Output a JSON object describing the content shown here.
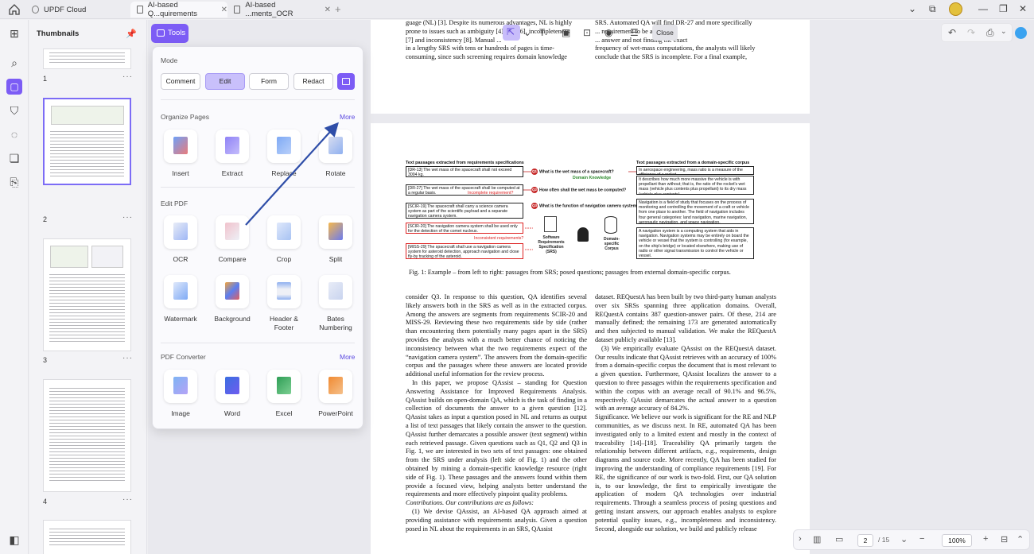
{
  "tabs": [
    {
      "label": "UPDF Cloud"
    },
    {
      "label": "AI-based Q...quirements"
    },
    {
      "label": "AI-based ...ments_OCR"
    }
  ],
  "sidebar": {
    "title": "Thumbnails",
    "pages": [
      "1",
      "2",
      "3",
      "4"
    ]
  },
  "tools_button": {
    "label": "Tools"
  },
  "popup": {
    "mode_title": "Mode",
    "modes": [
      "Comment",
      "Edit",
      "Form",
      "Redact"
    ],
    "active_mode": "Edit",
    "organize": {
      "title": "Organize Pages",
      "more": "More",
      "items": [
        "Insert",
        "Extract",
        "Replace",
        "Rotate"
      ]
    },
    "edit": {
      "title": "Edit PDF",
      "items": [
        "OCR",
        "Compare",
        "Crop",
        "Split",
        "Watermark",
        "Background",
        "Header & Footer",
        "Bates Numbering"
      ]
    },
    "converter": {
      "title": "PDF Converter",
      "more": "More",
      "items": [
        "Image",
        "Word",
        "Excel",
        "PowerPoint"
      ]
    }
  },
  "doc_toolbar": {
    "close": "Close"
  },
  "status": {
    "page": "2",
    "total": "/ 15",
    "zoom": "100%"
  },
  "page1": {
    "left": [
      "guage (NL) [3]. Despite its numerous advantages, NL is highly",
      "prone to issues such as ambiguity [4], [5], [6], incompleteness",
      "[7] and inconsistency [8]. Manual ...",
      "in a lengthy SRS with tens or hundreds of pages is time-",
      "consuming, since such screening requires domain knowledge"
    ],
    "right": [
      "SRS. Automated QA will find DR-27 and more specifically",
      "... requirement to be an",
      "... answer and not finding the exact",
      "frequency of wet-mass computations, the analysts will likely",
      "conclude that the SRS is incomplete. For a final example,"
    ]
  },
  "figure": {
    "left_title": "Text passages extracted from requirements specifications",
    "right_title": "Text passages extracted from a domain-specific corpus",
    "dr13": "[DR-13] The wet mass of the spacecraft shall not exceed 3004 kg.",
    "dr27": "[DR-27] The wet mass of the spacecraft shall be computed at a regular basis.",
    "incomplete": "Incomplete requirement?",
    "scir19": "[SCIR-19] The spacecraft shall carry a science camera system as part of the scientific payload and a separate navigation camera system.",
    "scir20": "[SCIR-20] The navigation camera system shall be used only for the detection of the comet nucleus.",
    "inconsistent": "Inconsistent requirements?",
    "miss29": "[MISS-29] The spacecraft shall use a navigation camera system for asteroid detection, approach navigation and close fly-by tracking of the asteroid.",
    "q1": "What is the wet mass of a spacecraft?",
    "domain_knowledge": "Domain Knowledge",
    "q2": "How often shall the wet mass be computed?",
    "q3": "What is the function of navigation camera system?",
    "srs_label": "Software Requirements Specification (SRS)",
    "corpus_label": "Domain-specific Corpus",
    "r1": "In aerospace engineering, mass ratio is a measure of the efficiency of a rocket.",
    "r2": "It describes how much more massive the vehicle is with propellant than without; that is, the ratio of the rocket's wet mass (vehicle plus contents plus propellant) to its dry mass (vehicle plus contents).",
    "r3": "Navigation is a field of study that focuses on the process of monitoring and controlling the movement of a craft or vehicle from one place to another. The field of navigation includes four general categories: land navigation, marine navigation, aeronautic navigation, and space navigation.",
    "r4": "A navigation system is a computing system that aids in navigation. Navigation systems may be entirely on board the vehicle or vessel that the system is controlling (for example, on the ship's bridge) or located elsewhere, making use of radio or other signal transmission to control the vehicle or vessel.",
    "caption": "Fig. 1: Example – from left to right: passages from SRS; posed questions; passages from external domain-specific corpus."
  },
  "page2": {
    "left": [
      "consider Q3. In response to this question, QA identifies several likely answers both in the SRS as well as in the extracted corpus. Among the answers are segments from requirements SCIR-20 and MISS-29. Reviewing these two requirements side by side (rather than encountering them potentially many pages apart in the SRS) provides the analysts with a much better chance of noticing the inconsistency between what the two requirements expect of the “navigation camera system”. The answers from the domain-specific corpus and the passages where these answers are located provide additional useful information for the review process.",
      "In this paper, we propose QAssist – standing for Question Answering Assistance for Improved Requirements Analysis. QAssist builds on open-domain QA, which is the task of finding in a collection of documents the answer to a given question [12]. QAssist takes as input a question posed in NL and returns as output a list of text passages that likely contain the answer to the question. QAssist further demarcates a possible answer (text segment) within each retrieved passage. Given questions such as Q1, Q2 and Q3 in Fig. 1, we are interested in two sets of text passages: one obtained from the SRS under analysis (left side of Fig. 1) and the other obtained by mining a domain-specific knowledge resource (right side of Fig. 1). These passages and the answers found within them provide a focused view, helping analysts better understand the requirements and more effectively pinpoint quality problems.",
      "Contributions. Our contributions are as follows:",
      "(1) We devise QAssist, an AI-based QA approach aimed at providing assistance with requirements analysis. Given a question posed in NL about the requirements in an SRS, QAssist"
    ],
    "right": [
      "dataset. REQuestA has been built by two third-party human analysts over six SRSs spanning three application domains. Overall, REQuestA contains 387 question-answer pairs. Of these, 214 are manually defined; the remaining 173 are generated automatically and then subjected to manual validation. We make the REQuestA dataset publicly available [13].",
      "(3) We empirically evaluate QAssist on the REQuestA dataset. Our results indicate that QAssist retrieves with an accuracy of 100% from a domain-specific corpus the document that is most relevant to a given question. Furthermore, QAssist localizes the answer to a question to three passages within the requirements specification and within the corpus with an average recall of 90.1% and 96.5%, respectively. QAssist demarcates the actual answer to a question with an average accuracy of 84.2%.",
      "Significance. We believe our work is significant for the RE and NLP communities, as we discuss next. In RE, automated QA has been investigated only to a limited extent and mostly in the context of traceability [14]–[18]. Traceability QA primarily targets the relationship between different artifacts, e.g., requirements, design diagrams and source code. More recently, QA has been studied for improving the understanding of compliance requirements [19]. For RE, the significance of our work is two-fold. First, our QA solution is, to our knowledge, the first to empirically investigate the application of modern QA technologies over industrial requirements. Through a seamless process of posing questions and getting instant answers, our approach enables analysts to explore potential quality issues, e.g., incompleteness and inconsistency. Second, alongside our solution, we build and publicly release"
    ]
  },
  "colors": {
    "accent": "#7c5cf5",
    "link_green": "#2eae6b",
    "link_red": "#e33333",
    "highlight": "#c9ef9c"
  }
}
